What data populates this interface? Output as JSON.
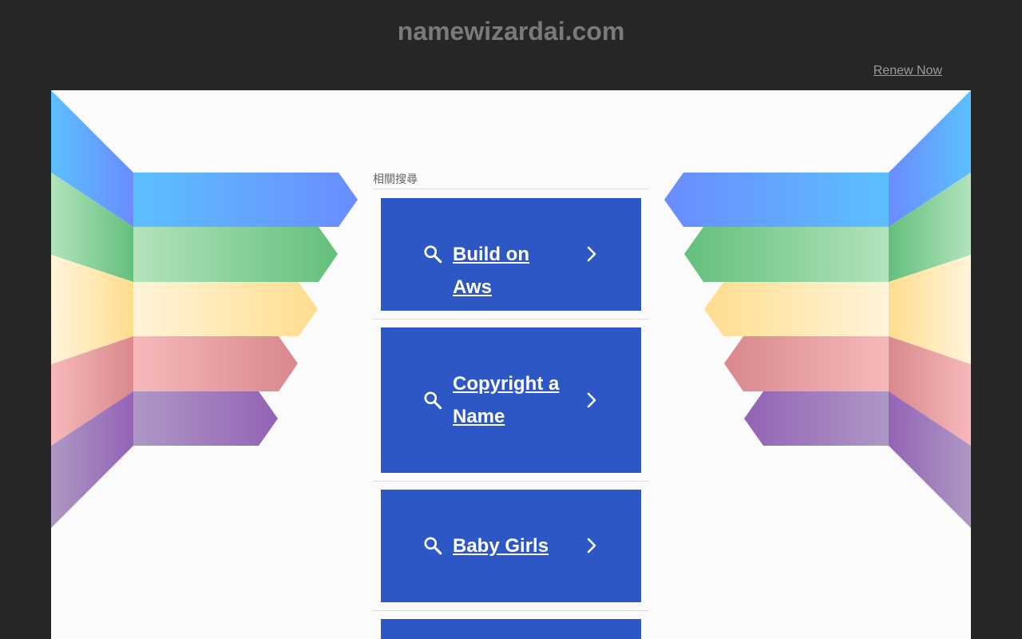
{
  "header": {
    "domain": "namewizardai.com",
    "renew_label": "Renew Now"
  },
  "related": {
    "heading": "相關搜尋",
    "items": [
      {
        "label": "Build on Aws"
      },
      {
        "label": "Copyright a Name"
      },
      {
        "label": "Baby Girls"
      },
      {
        "label": ""
      }
    ]
  },
  "colors": {
    "background": "#262626",
    "panel": "#fbfbfb",
    "card": "#2d57c4",
    "wing_blue": "#66b6ff",
    "wing_green": "#6cc38a",
    "wing_yellow": "#ffe3a0",
    "wing_red": "#e39a9c",
    "wing_purple": "#9b73b9"
  },
  "icons": {
    "search": "search-icon",
    "chevron": "chevron-right-icon"
  }
}
